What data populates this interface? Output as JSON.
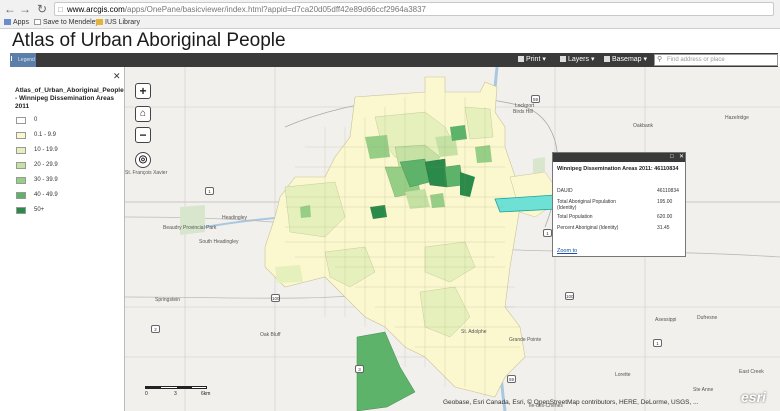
{
  "browser": {
    "url_domain": "www.arcgis.com",
    "url_rest": "/apps/OnePane/basicviewer/index.html?appid=d7ca20d05dff42e89d66ccf2964a3837",
    "bookmarks": [
      "Apps",
      "Save to Mendeley",
      "IUS Library"
    ]
  },
  "app": {
    "title": "Atlas of Urban Aboriginal People"
  },
  "toolbar": {
    "legend_label": "Legend",
    "print_label": "Print",
    "layers_label": "Layers",
    "basemap_label": "Basemap",
    "search_placeholder": "Find address or place"
  },
  "legend": {
    "title": "Atlas_of_Urban_Aboriginal_People - Winnipeg Dissemination Areas 2011",
    "items": [
      {
        "label": "0",
        "color": "#ffffff"
      },
      {
        "label": "0.1 - 9.9",
        "color": "#fbf7cf"
      },
      {
        "label": "10 - 19.9",
        "color": "#e6f0bd"
      },
      {
        "label": "20 - 29.9",
        "color": "#c5e2a4"
      },
      {
        "label": "30 - 39.9",
        "color": "#97ce86"
      },
      {
        "label": "40 - 49.9",
        "color": "#5eb36a"
      },
      {
        "label": "50+",
        "color": "#2a8a4a"
      }
    ]
  },
  "popup": {
    "title": "Winnipeg Dissemination Areas 2011: 46110834",
    "rows": [
      {
        "key": "DAUID",
        "value": "46110834"
      },
      {
        "key": "Total Aboriginal Population (Identity)",
        "value": "195.00"
      },
      {
        "key": "Total Population",
        "value": "620.00"
      },
      {
        "key": "Percent Aboriginal (Identity)",
        "value": "31.45"
      }
    ],
    "zoom_link": "Zoom to"
  },
  "map": {
    "attribution": "Geobase, Esri Canada, Esri, © OpenStreetMap contributors, HERE, DeLorme, USGS, ...",
    "logo": "esri",
    "scale_labels": [
      "0",
      "3",
      "6km"
    ],
    "place_labels": {
      "lockport": "Lockport",
      "birds_hill": "Birds Hill",
      "oakbank": "Oakbank",
      "hazelridge": "Hazelridge",
      "st_francois": "St. François Xavier",
      "headingley": "Headingley",
      "beaudry": "Beaudry Provincial Park",
      "south_headingley": "South Headingley",
      "springstein": "Springstein",
      "oak_bluff": "Oak Bluff",
      "lorette": "Lorette",
      "ile_des_chenes": "Île-des-Chênes",
      "grande_pointe": "Grande Pointe",
      "dufresne": "Dufresne",
      "asessippi": "Asessippi",
      "ste_anne": "Ste Anne",
      "east_creek": "East Creek",
      "st_adolphe": "St. Adolphe"
    },
    "highways": [
      "59",
      "1",
      "1",
      "100",
      "100",
      "2",
      "3",
      "59",
      "1"
    ]
  }
}
